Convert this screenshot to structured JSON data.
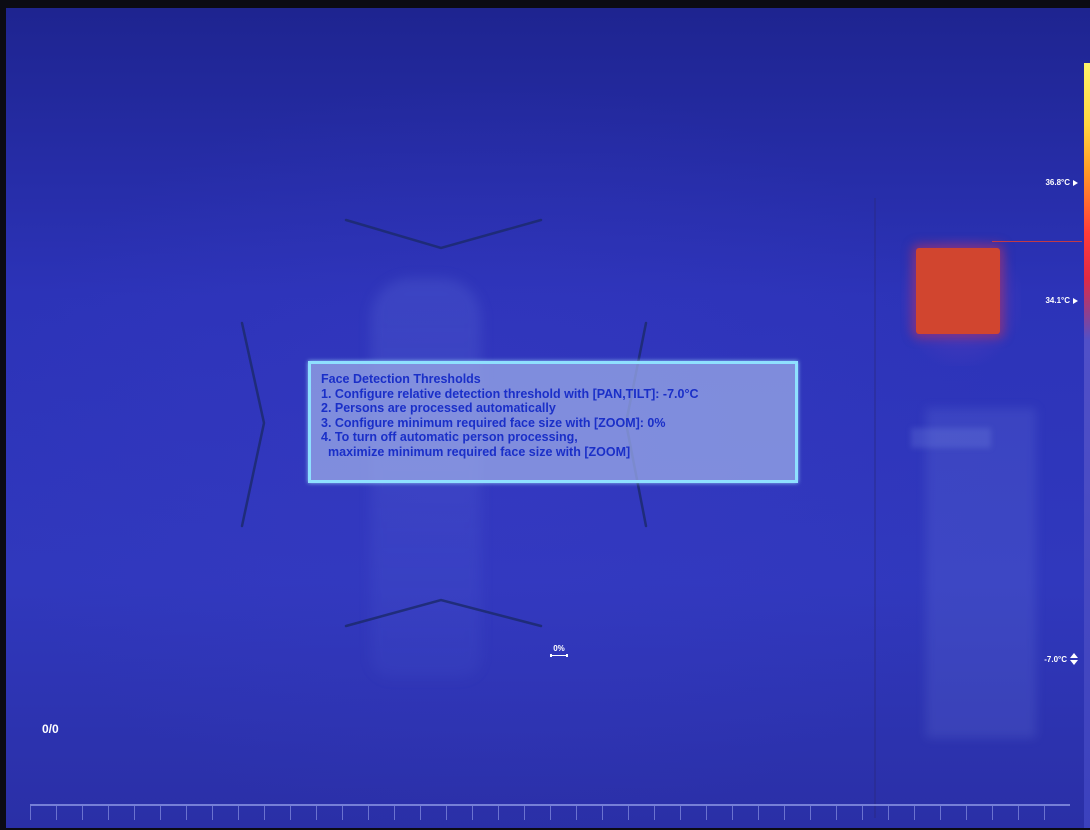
{
  "info_box": {
    "title": "Face Detection Thresholds",
    "line1": "1. Configure relative detection threshold with [PAN,TILT]: -7.0°C",
    "line2": "2. Persons are processed automatically",
    "line3": "3. Configure minimum required face size with [ZOOM]: 0%",
    "line4a": "4. To turn off automatic person processing,",
    "line4b": "maximize minimum required face size with [ZOOM]"
  },
  "temperature_scale": {
    "max_label": "36.8°C",
    "ref_label": "34.1°C",
    "threshold_label": "-7.0°C"
  },
  "zoom_indicator": {
    "value": "0%"
  },
  "person_counter": "0/0",
  "colors": {
    "background": "#2c33b8",
    "box_border": "#8fe0ff",
    "box_text": "#1a2fc8",
    "hot_spot": "#d1452f"
  },
  "icons": {
    "zoom": "zoom-width-icon",
    "threshold_adjust": "up-down-arrows-icon",
    "scale_marker": "triangle-pointer-icon"
  }
}
